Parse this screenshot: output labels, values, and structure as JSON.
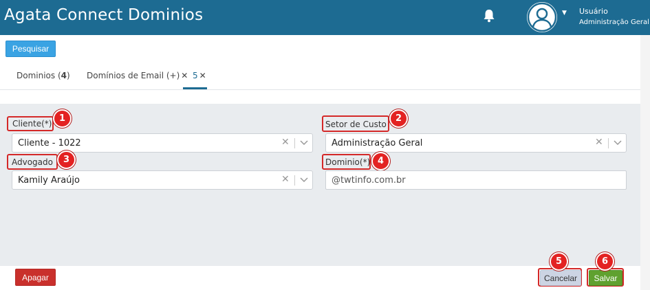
{
  "header": {
    "app_title": "Agata Connect Dominios",
    "notification_icon": "bell-icon",
    "avatar_icon": "user-avatar-icon",
    "user_name": "Usuário",
    "user_role": "Administração Geral",
    "colors": {
      "bar": "#1d6b92",
      "text": "#ffffff"
    }
  },
  "toolbar": {
    "search_label": "Pesquisar"
  },
  "tabs": [
    {
      "label": "Dominios (",
      "count": "4",
      "suffix": ")"
    },
    {
      "label": "Domínios de Email (+)",
      "close": "✕"
    },
    {
      "label": "5",
      "close": "✕",
      "active": true
    }
  ],
  "form": {
    "cliente": {
      "label": "Cliente(*)",
      "value": "Cliente - 1022",
      "marker": "1"
    },
    "setor": {
      "label": "Setor de Custo",
      "value": "Administração Geral",
      "marker": "2"
    },
    "advogado": {
      "label": "Advogado",
      "value": "Kamily Araújo",
      "marker": "3"
    },
    "dominio": {
      "label": "Dominio(*)",
      "value": "@twtinfo.com.br",
      "marker": "4"
    }
  },
  "footer": {
    "delete_label": "Apagar",
    "cancel_label": "Cancelar",
    "cancel_marker": "5",
    "save_label": "Salvar",
    "save_marker": "6"
  },
  "colors": {
    "annotation": "#e32222",
    "delete": "#c9302c",
    "save": "#5fa12f",
    "primary": "#3aa3e3"
  }
}
